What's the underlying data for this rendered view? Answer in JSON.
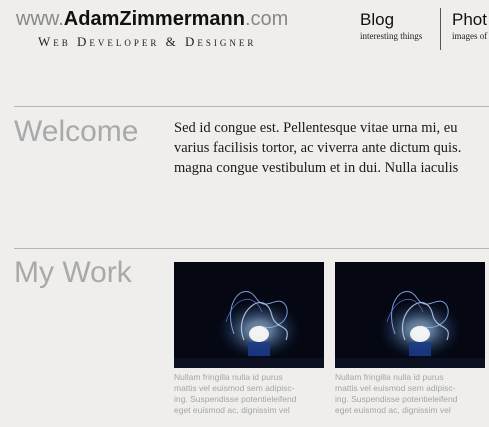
{
  "logo": {
    "prefix": "www.",
    "name": "AdamZimmermann",
    "suffix": ".com",
    "tagline": "Web Developer & Designer"
  },
  "nav": [
    {
      "title": "Blog",
      "subtitle": "interesting things"
    },
    {
      "title": "Phot",
      "subtitle": "images of"
    }
  ],
  "welcome": {
    "heading": "Welcome",
    "lines": [
      "Sed id congue est. Pellentesque vitae urna mi, eu",
      "varius facilisis tortor, ac viverra ante dictum quis.",
      "magna congue vestibulum et in dui. Nulla iaculis"
    ]
  },
  "work": {
    "heading": "My Work",
    "items": [
      {
        "caption": [
          "Nullam fringilla nulla id purus",
          "mattis vel euismod sem adipisc-",
          "ing. Suspendisse potentieleifend",
          "eget euismod ac, dignissim vel"
        ]
      },
      {
        "caption": [
          "Nullam fringilla nulla id purus",
          "mattis vel euismod sem adipisc-",
          "ing. Suspendisse potentieleifend",
          "eget euismod ac, dignissim vel"
        ]
      }
    ]
  },
  "colors": {
    "background": "#efeeed",
    "heading": "#a9a9a9",
    "logo_gray": "#888888",
    "rule": "#b6b6b6"
  }
}
